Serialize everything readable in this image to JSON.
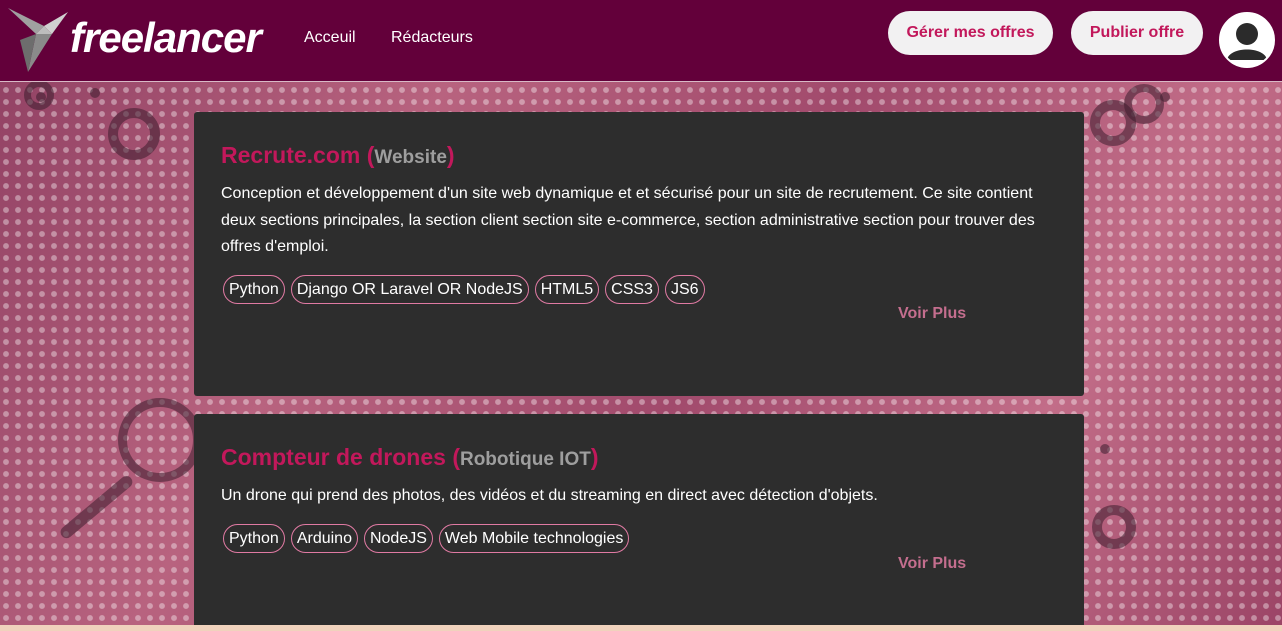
{
  "brand": {
    "logo_text": "freelancer"
  },
  "nav": {
    "links": [
      {
        "label": "Acceuil"
      },
      {
        "label": "Rédacteurs"
      }
    ],
    "buttons": {
      "manage_offers": "Gérer mes offres",
      "publish_offer": "Publier offre"
    }
  },
  "colors": {
    "navbar": "#63003a",
    "accent": "#c2185b",
    "card_bg": "#2d2d2d",
    "category_gray": "#9e9e9e",
    "link_pink": "#c46e8e"
  },
  "offers": [
    {
      "title": "Recrute.com",
      "open_paren": "(",
      "category": "Website",
      "close_paren": ")",
      "description": "Conception et développement d'un site web dynamique et et sécurisé pour un site de recrutement. Ce site contient deux sections principales, la section client section site e-commerce, section administrative section pour trouver des offres d'emploi.",
      "tags": [
        "Python",
        "Django OR Laravel OR NodeJS",
        "HTML5",
        "CSS3",
        "JS6"
      ],
      "more_label": "Voir Plus"
    },
    {
      "title": "Compteur de drones",
      "open_paren": "(",
      "category": "Robotique IOT",
      "close_paren": ")",
      "description": "Un drone qui prend des photos, des vidéos et du streaming en direct avec détection d'objets.",
      "tags": [
        "Python",
        "Arduino",
        "NodeJS",
        "Web Mobile technologies"
      ],
      "more_label": "Voir Plus"
    }
  ],
  "icons": {
    "logo_mark": "origami-bird-icon",
    "avatar": "user-avatar-icon"
  }
}
